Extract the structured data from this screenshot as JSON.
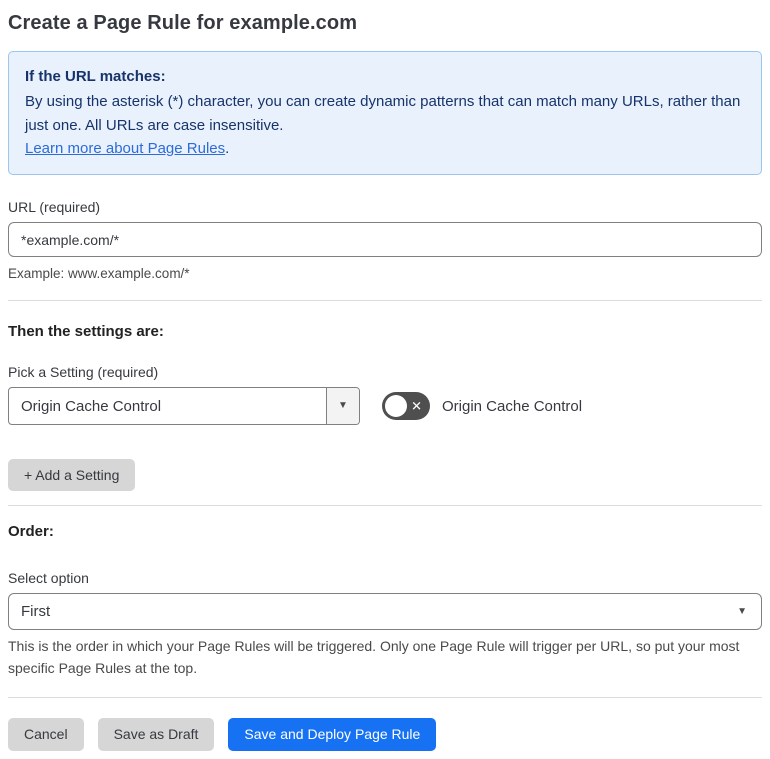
{
  "page": {
    "title": "Create a Page Rule for example.com"
  },
  "info_box": {
    "heading": "If the URL matches:",
    "body": "By using the asterisk (*) character, you can create dynamic patterns that can match many URLs, rather than just one. All URLs are case insensitive.",
    "link_label": "Learn more about Page Rules",
    "link_suffix": "."
  },
  "url_field": {
    "label": "URL (required)",
    "value": "*example.com/*",
    "helper": "Example: www.example.com/*"
  },
  "settings_section": {
    "heading": "Then the settings are:",
    "picker_label": "Pick a Setting (required)",
    "picker_value": "Origin Cache Control",
    "toggle_label": "Origin Cache Control",
    "toggle_state": "off",
    "toggle_glyph": "✕",
    "add_setting_label": "+ Add a Setting"
  },
  "order_section": {
    "heading": "Order:",
    "select_label": "Select option",
    "select_value": "First",
    "helper": "This is the order in which your Page Rules will be triggered. Only one Page Rule will trigger per URL, so put your most specific Page Rules at the top."
  },
  "footer": {
    "cancel_label": "Cancel",
    "save_draft_label": "Save as Draft",
    "save_deploy_label": "Save and Deploy Page Rule"
  },
  "colors": {
    "accent_blue": "#1672f2",
    "info_bg": "#e9f2fc",
    "info_border": "#9cc6ee",
    "info_text": "#17336b",
    "link_blue": "#2d6bd8",
    "toggle_off": "#4f4f4f",
    "button_gray": "#d6d6d6"
  }
}
